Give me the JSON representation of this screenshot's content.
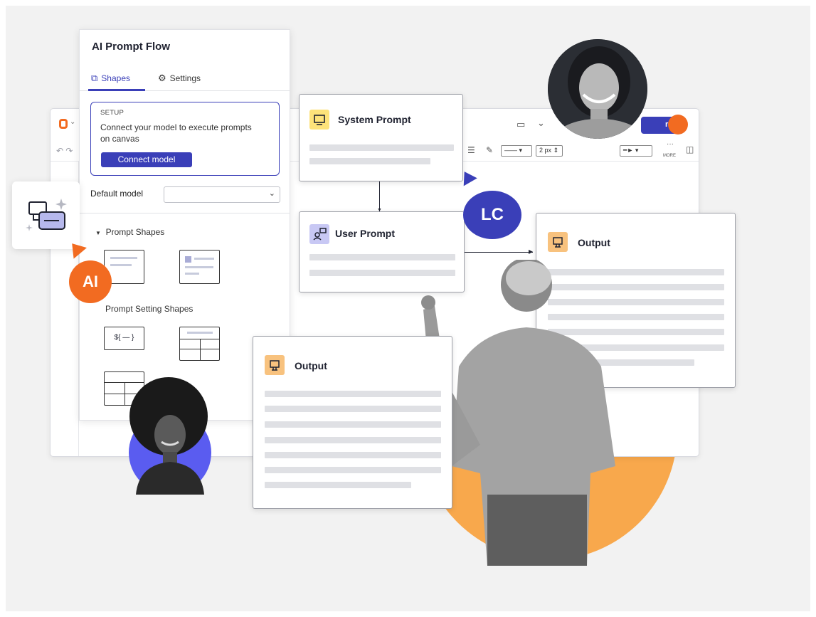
{
  "panel": {
    "title": "AI Prompt Flow",
    "tabs": [
      {
        "label": "Shapes",
        "icon": "shapes-icon",
        "active": true
      },
      {
        "label": "Settings",
        "icon": "gear-icon",
        "active": false
      }
    ],
    "setup": {
      "label": "SETUP",
      "text": "Connect your model to execute prompts on canvas",
      "button": "Connect model"
    },
    "default_model": {
      "label": "Default model",
      "value": ""
    },
    "sections": [
      {
        "label": "Prompt Shapes",
        "icon": "triangle-down-icon"
      },
      {
        "label": "Prompt Setting Shapes"
      }
    ],
    "variable_shape_text": "${ — }"
  },
  "editor": {
    "share_label": "re",
    "line_width": "2 px",
    "more_label": "MORE"
  },
  "cards": {
    "system_prompt": {
      "title": "System Prompt",
      "icon": "monitor-icon",
      "accent": "#fde27a"
    },
    "user_prompt": {
      "title": "User Prompt",
      "icon": "user-prompt-icon",
      "accent": "#c8c8f4"
    },
    "output_right": {
      "title": "Output",
      "icon": "output-icon",
      "accent": "#f8c27e"
    },
    "output_left": {
      "title": "Output",
      "icon": "output-icon",
      "accent": "#f8c27e"
    }
  },
  "badges": {
    "ai": "AI",
    "lc": "LC"
  },
  "colors": {
    "brand_blue": "#3a3fb8",
    "brand_orange": "#f26b21",
    "accent_orange": "#f8a84c",
    "accent_purple": "#5a5cf0"
  }
}
